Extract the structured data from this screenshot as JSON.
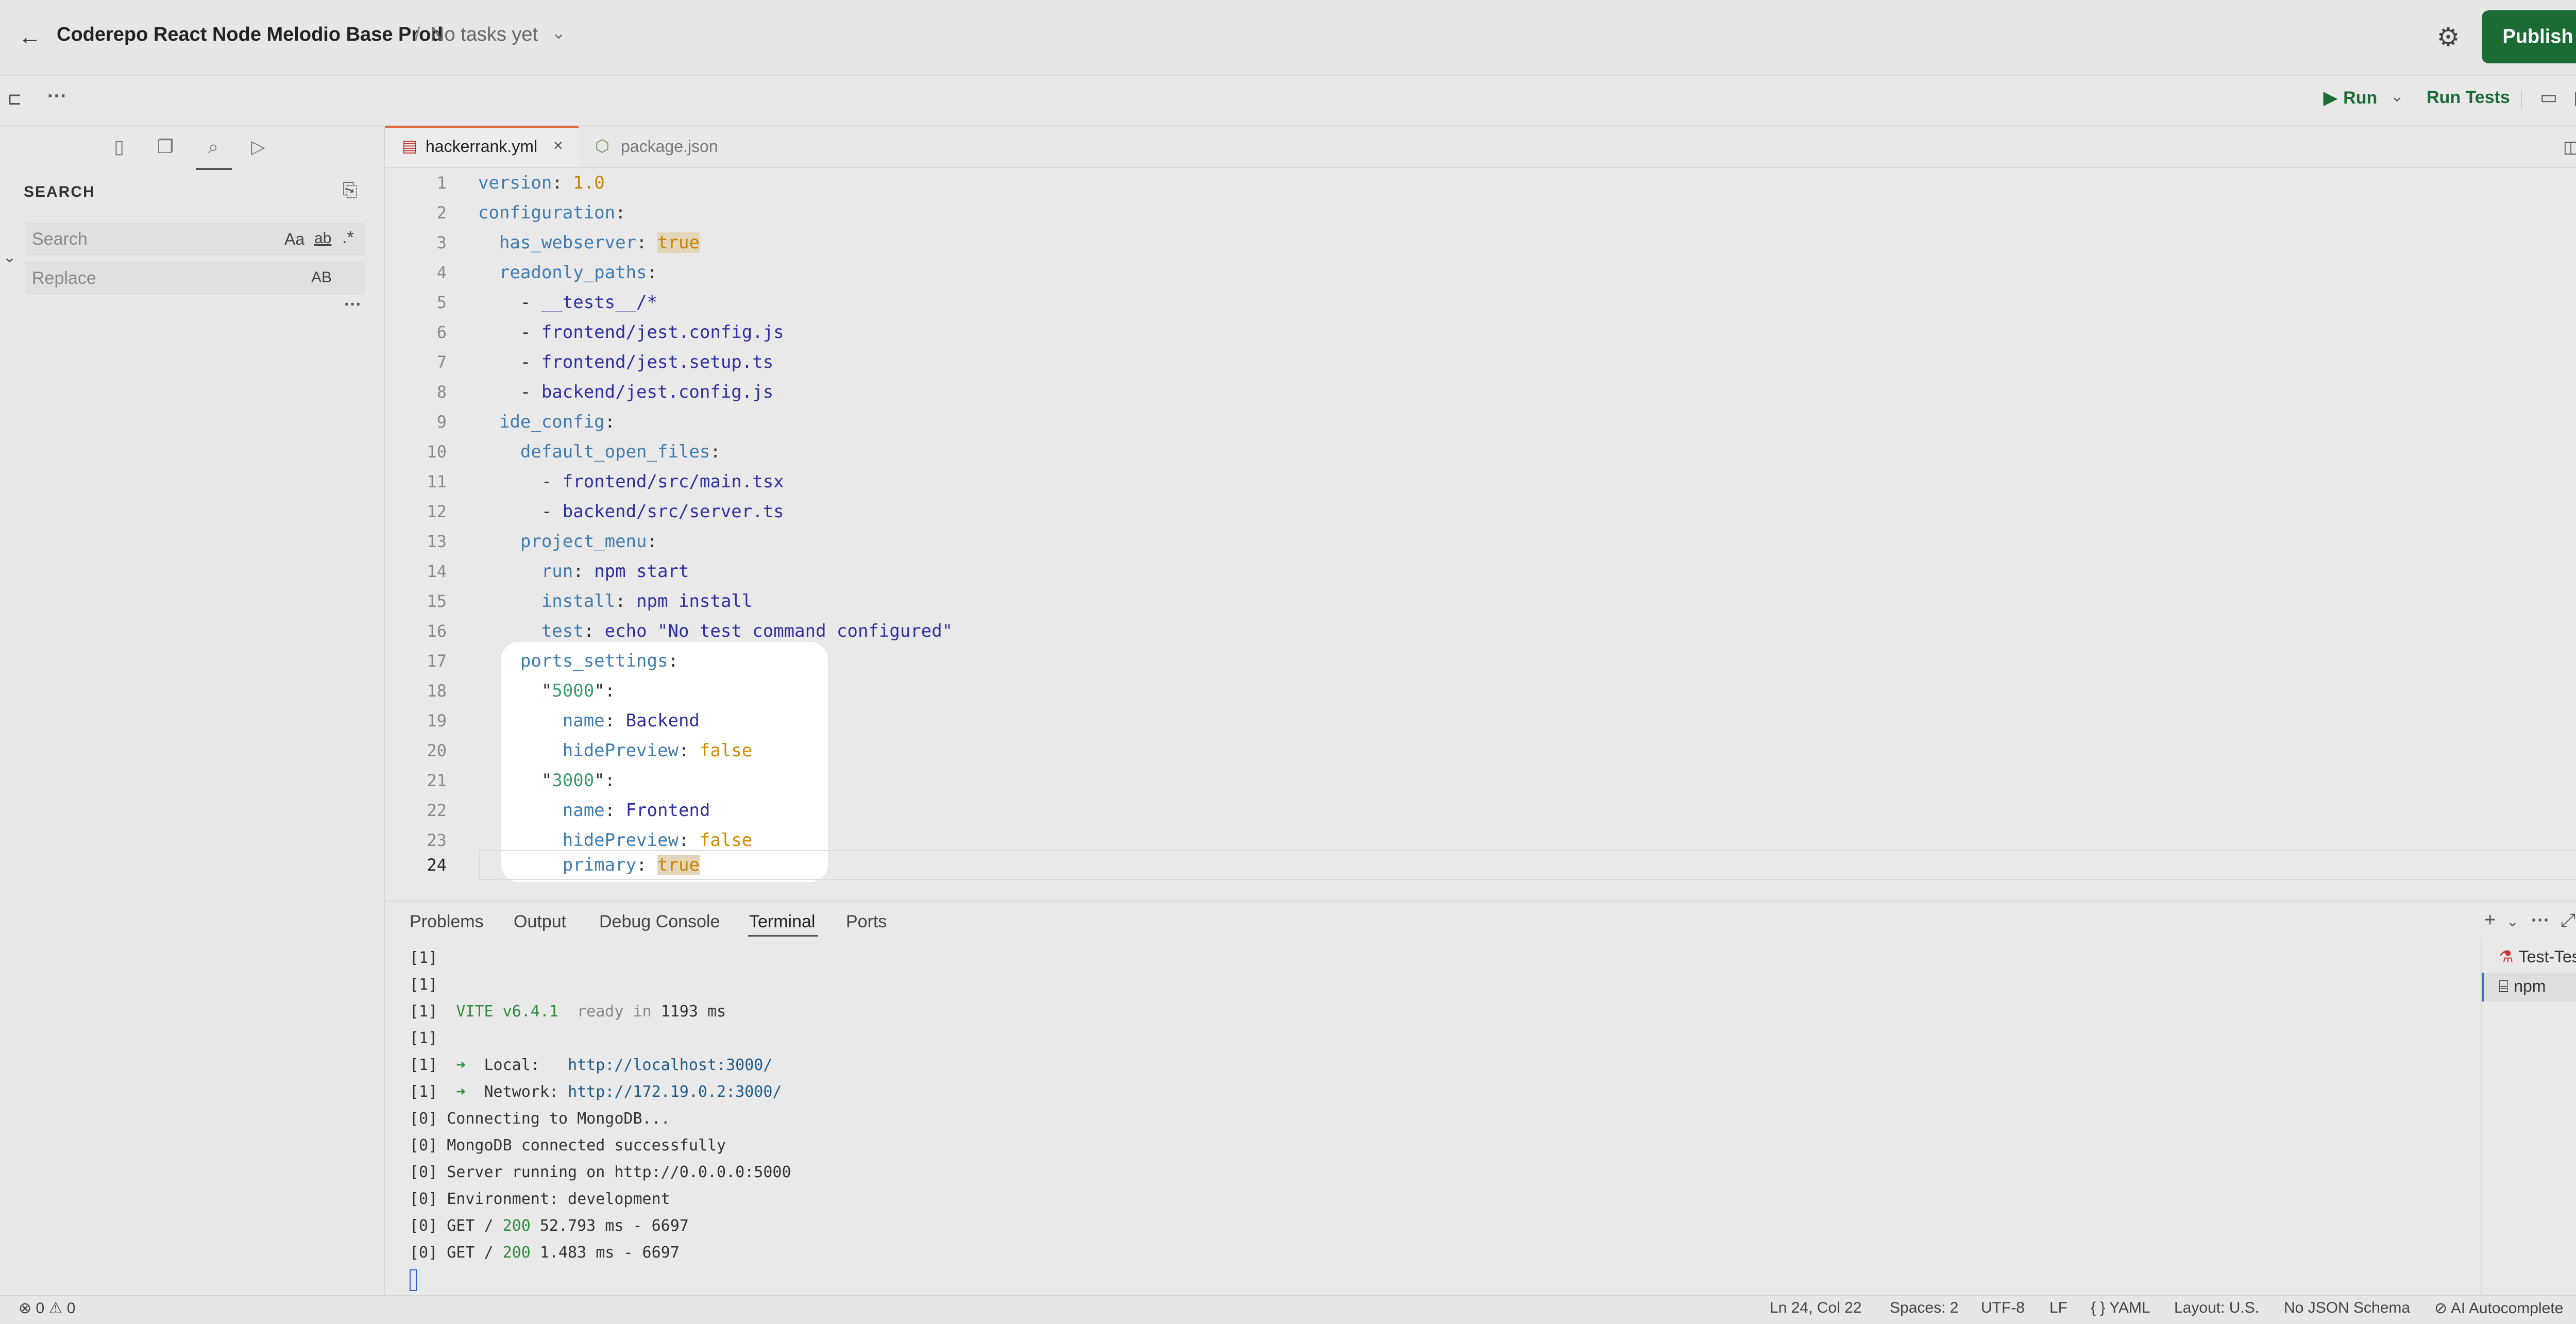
{
  "header": {
    "back_icon": "arrow-left-icon",
    "project_title": "Coderepo React Node Melodio Base Prod",
    "separator": "/",
    "task_label": "No tasks yet",
    "settings_icon": "gear-icon",
    "publish_label": "Publish",
    "publish_color": "#1b6b35"
  },
  "toolbar": {
    "run_label": "Run",
    "run_tests_label": "Run Tests"
  },
  "sidebar": {
    "title": "SEARCH",
    "search_placeholder": "Search",
    "replace_placeholder": "Replace",
    "match_case": "Aa",
    "match_word": "ab",
    "regex": ".*",
    "preserve_case": "AB"
  },
  "tabs": [
    {
      "label": "hackerrank.yml",
      "active": true
    },
    {
      "label": "package.json",
      "active": false
    }
  ],
  "editor": {
    "line_numbers": [
      "1",
      "2",
      "3",
      "4",
      "5",
      "6",
      "7",
      "8",
      "9",
      "10",
      "11",
      "12",
      "13",
      "14",
      "15",
      "16",
      "17",
      "18",
      "19",
      "20",
      "21",
      "22",
      "23",
      "24"
    ],
    "lines": {
      "l1_key": "version",
      "l1_val": "1.0",
      "l2_key": "configuration",
      "l3_key": "has_webserver",
      "l3_val": "true",
      "l4_key": "readonly_paths",
      "l5_val": "__tests__/*",
      "l6_val": "frontend/jest.config.js",
      "l7_val": "frontend/jest.setup.ts",
      "l8_val": "backend/jest.config.js",
      "l9_key": "ide_config",
      "l10_key": "default_open_files",
      "l11_val": "frontend/src/main.tsx",
      "l12_val": "backend/src/server.ts",
      "l13_key": "project_menu",
      "l14_key": "run",
      "l14_val": "npm start",
      "l15_key": "install",
      "l15_val": "npm install",
      "l16_key": "test",
      "l16_val": "echo \"No test command configured\"",
      "l17_key": "ports_settings",
      "l18_key": "5000",
      "l19_key": "name",
      "l19_val": "Backend",
      "l20_key": "hidePreview",
      "l20_val": "false",
      "l21_key": "3000",
      "l22_key": "name",
      "l22_val": "Frontend",
      "l23_key": "hidePreview",
      "l23_val": "false",
      "l24_key": "primary",
      "l24_val": "true"
    }
  },
  "panel": {
    "tabs": [
      "Problems",
      "Output",
      "Debug Console",
      "Terminal",
      "Ports"
    ],
    "active_tab": "Terminal",
    "terminal": {
      "t1": "[1]",
      "t2": "[1]",
      "t3_prefix": "[1]  ",
      "t3_vite": "VITE v6.4.1",
      "t3_ready": "ready in",
      "t3_ms": "1193 ms",
      "t4": "[1]",
      "t5_prefix": "[1]  ",
      "t5_arrow": "➜",
      "t5_label": "  Local:   ",
      "t5_url": "http://localhost:3000/",
      "t6_prefix": "[1]  ",
      "t6_arrow": "➜",
      "t6_label": "  Network: ",
      "t6_url": "http://172.19.0.2:3000/",
      "t7": "[0] Connecting to MongoDB...",
      "t8": "[0] MongoDB connected successfully",
      "t9": "[0] Server running on http://0.0.0.0:5000",
      "t10": "[0] Environment: development",
      "t11_pre": "[0] GET / ",
      "t11_code": "200",
      "t11_post": " 52.793 ms - 6697",
      "t12_pre": "[0] GET / ",
      "t12_code": "200",
      "t12_post": " 1.483 ms - 6697"
    },
    "terminal_list": [
      "Test-Test",
      "npm"
    ]
  },
  "statusbar": {
    "errors": "0",
    "warnings": "0",
    "position": "Ln 24, Col 22",
    "spaces": "Spaces: 2",
    "encoding": "UTF-8",
    "eol": "LF",
    "language": "YAML",
    "layout": "Layout: U.S.",
    "schema": "No JSON Schema",
    "ai": "AI Autocomplete"
  }
}
